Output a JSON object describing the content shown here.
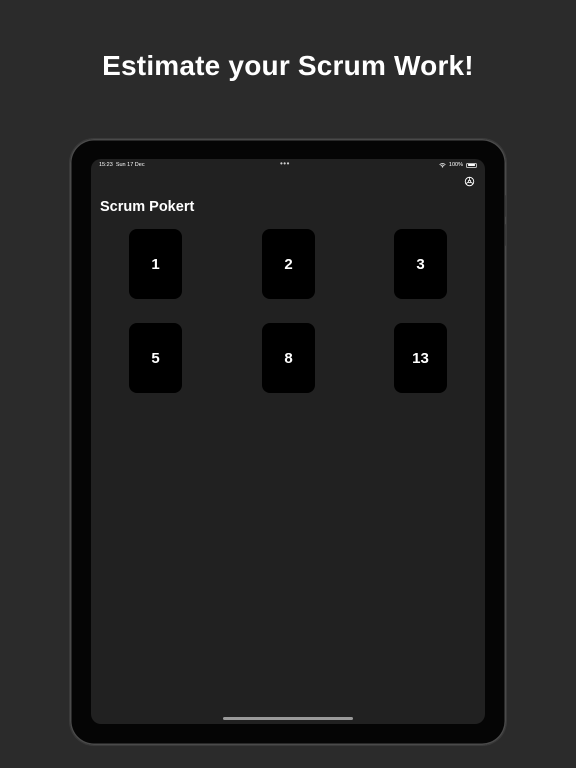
{
  "headline": "Estimate your Scrum Work!",
  "status_bar": {
    "time": "15:23",
    "date": "Sun 17 Dec",
    "dots": "•••",
    "battery": "100%"
  },
  "icons": {
    "settings": "settings-icon",
    "wifi": "wifi-icon",
    "battery": "battery-icon"
  },
  "app": {
    "title": "Scrum Pokert",
    "cards": [
      "1",
      "2",
      "3",
      "5",
      "8",
      "13"
    ]
  },
  "colors": {
    "background": "#2b2b2b",
    "screen": "#212121",
    "card": "#000000",
    "text": "#ffffff"
  }
}
